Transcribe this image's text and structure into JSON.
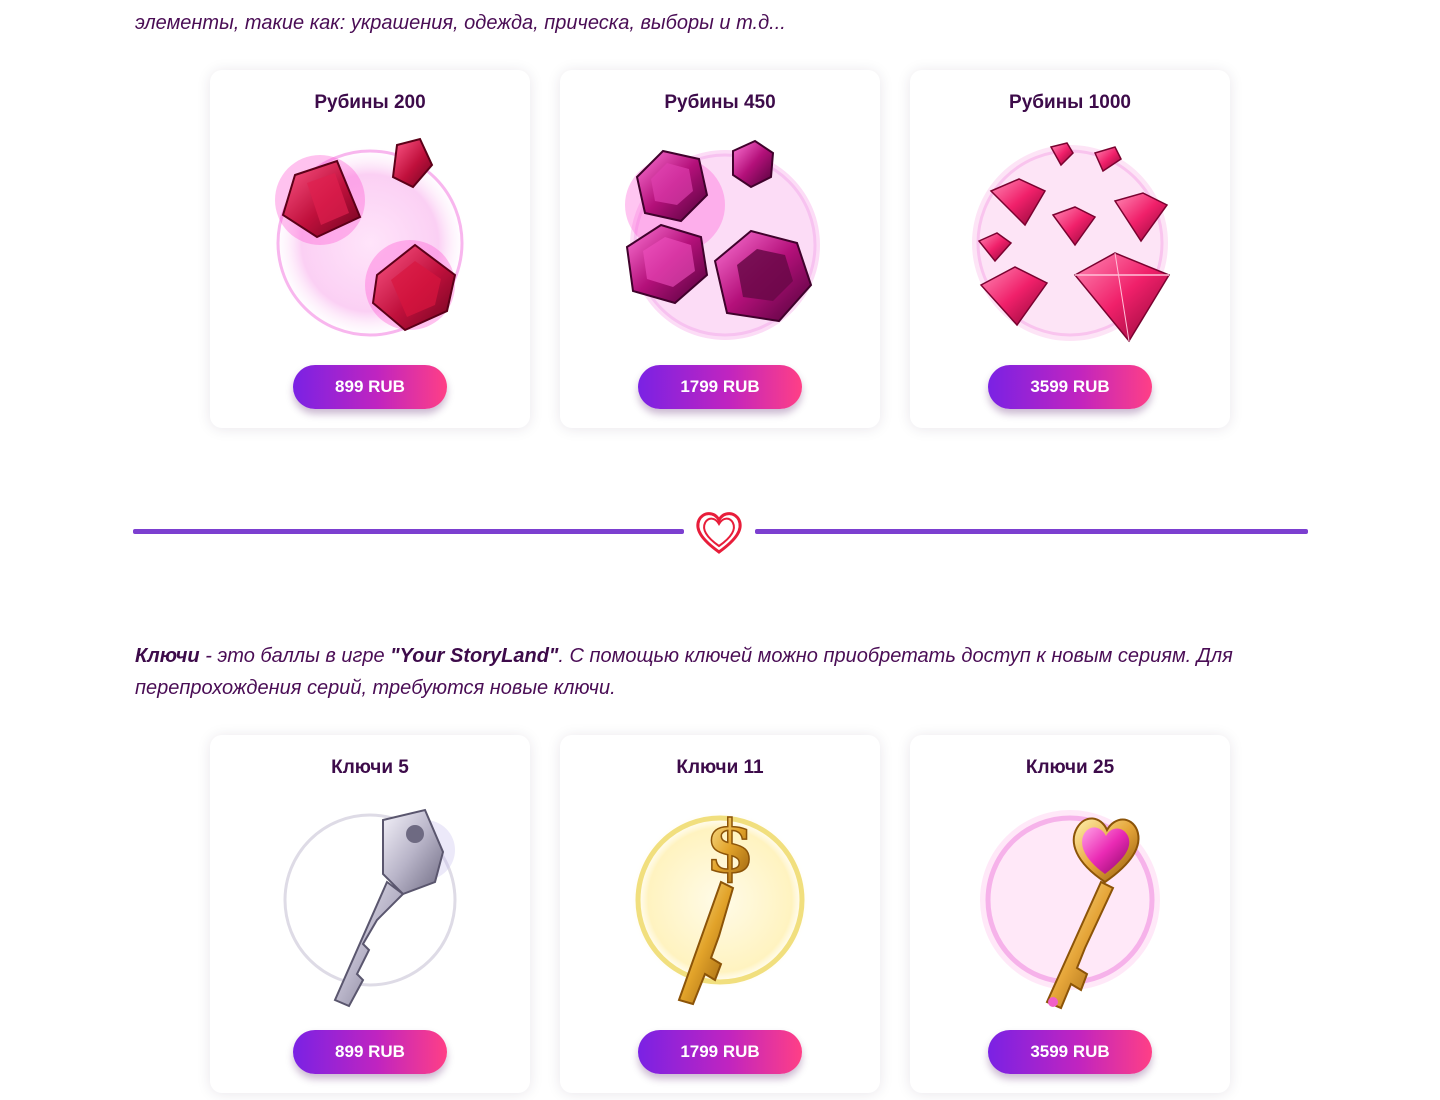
{
  "intro_tail": "элементы, такие как: украшения, одежда, прическа, выборы и т.д...",
  "rubies": {
    "items": [
      {
        "title": "Рубины 200",
        "price": "899 RUB",
        "icon": "ruby-crystals-icon"
      },
      {
        "title": "Рубины 450",
        "price": "1799 RUB",
        "icon": "hexagon-rubies-icon"
      },
      {
        "title": "Рубины 1000",
        "price": "3599 RUB",
        "icon": "diamond-rubies-icon"
      }
    ]
  },
  "divider": {
    "icon": "heart-icon"
  },
  "keys_description": {
    "term": "Ключи",
    "part1": " - это баллы в игре ",
    "game": "\"Your StoryLand\"",
    "part2": ". С помощью ключей можно приобретать доступ к новым сериям. Для перепрохождения серий, требуются новые ключи."
  },
  "keys": {
    "items": [
      {
        "title": "Ключи 5",
        "price": "899 RUB",
        "icon": "silver-key-icon"
      },
      {
        "title": "Ключи 11",
        "price": "1799 RUB",
        "icon": "gold-dollar-key-icon"
      },
      {
        "title": "Ключи 25",
        "price": "3599 RUB",
        "icon": "heart-gem-key-icon"
      }
    ]
  },
  "colors": {
    "accent_purple": "#7c3fd0",
    "button_start": "#7a22e4",
    "button_end": "#ff3f86",
    "text": "#4a0d55"
  }
}
